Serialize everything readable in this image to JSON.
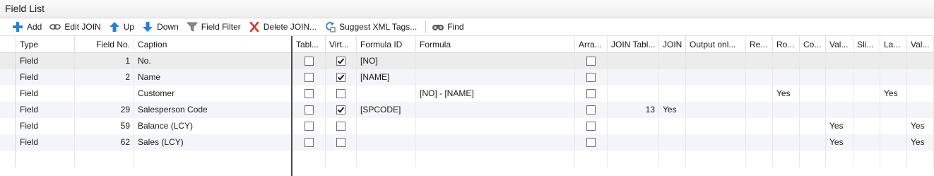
{
  "window": {
    "title": "Field List"
  },
  "toolbar": {
    "add": "Add",
    "edit_join": "Edit JOIN",
    "up": "Up",
    "down": "Down",
    "field_filter": "Field Filter",
    "delete_join": "Delete JOIN...",
    "suggest_xml": "Suggest XML Tags...",
    "find": "Find"
  },
  "columns": {
    "type": "Type",
    "field_no": "Field No.",
    "caption": "Caption",
    "table": "Tabl...",
    "virtual": "Virt...",
    "formula_id": "Formula ID",
    "formula": "Formula",
    "array": "Arra...",
    "join_table": "JOIN Tabl...",
    "join": "JOIN",
    "output_only": "Output onl...",
    "re": "Re...",
    "ro": "Ro...",
    "co": "Co...",
    "val1": "Val...",
    "sli": "Sli...",
    "la": "La...",
    "val2": "Val..."
  },
  "rows": [
    {
      "type": "Field",
      "field_no": "1",
      "caption": "No.",
      "table": false,
      "virtual": true,
      "formula_id": "[NO]",
      "formula": "",
      "array": false,
      "join_table": "",
      "join": "",
      "ro": "",
      "val1": "",
      "la": "",
      "val2": ""
    },
    {
      "type": "Field",
      "field_no": "2",
      "caption": "Name",
      "table": false,
      "virtual": true,
      "formula_id": "[NAME]",
      "formula": "",
      "array": false,
      "join_table": "",
      "join": "",
      "ro": "",
      "val1": "",
      "la": "",
      "val2": ""
    },
    {
      "type": "Field",
      "field_no": "",
      "caption": "Customer",
      "table": false,
      "virtual": false,
      "formula_id": "",
      "formula": "[NO] - [NAME]",
      "array": false,
      "join_table": "",
      "join": "",
      "ro": "Yes",
      "val1": "",
      "la": "Yes",
      "val2": ""
    },
    {
      "type": "Field",
      "field_no": "29",
      "caption": "Salesperson Code",
      "table": false,
      "virtual": true,
      "formula_id": "[SPCODE]",
      "formula": "",
      "array": false,
      "join_table": "13",
      "join": "Yes",
      "ro": "",
      "val1": "",
      "la": "",
      "val2": ""
    },
    {
      "type": "Field",
      "field_no": "59",
      "caption": "Balance (LCY)",
      "table": false,
      "virtual": false,
      "formula_id": "",
      "formula": "",
      "array": false,
      "join_table": "",
      "join": "",
      "ro": "",
      "val1": "Yes",
      "la": "",
      "val2": "Yes"
    },
    {
      "type": "Field",
      "field_no": "62",
      "caption": "Sales (LCY)",
      "table": false,
      "virtual": false,
      "formula_id": "",
      "formula": "",
      "array": false,
      "join_table": "",
      "join": "",
      "ro": "",
      "val1": "Yes",
      "la": "",
      "val2": "Yes"
    }
  ],
  "colors": {
    "add_icon": "#2a7fd4",
    "arrow_icon": "#2a7fd4",
    "delete_icon": "#d23b2b",
    "filter_icon": "#6b6b6b",
    "freeze_line": "#4a4a4a"
  }
}
